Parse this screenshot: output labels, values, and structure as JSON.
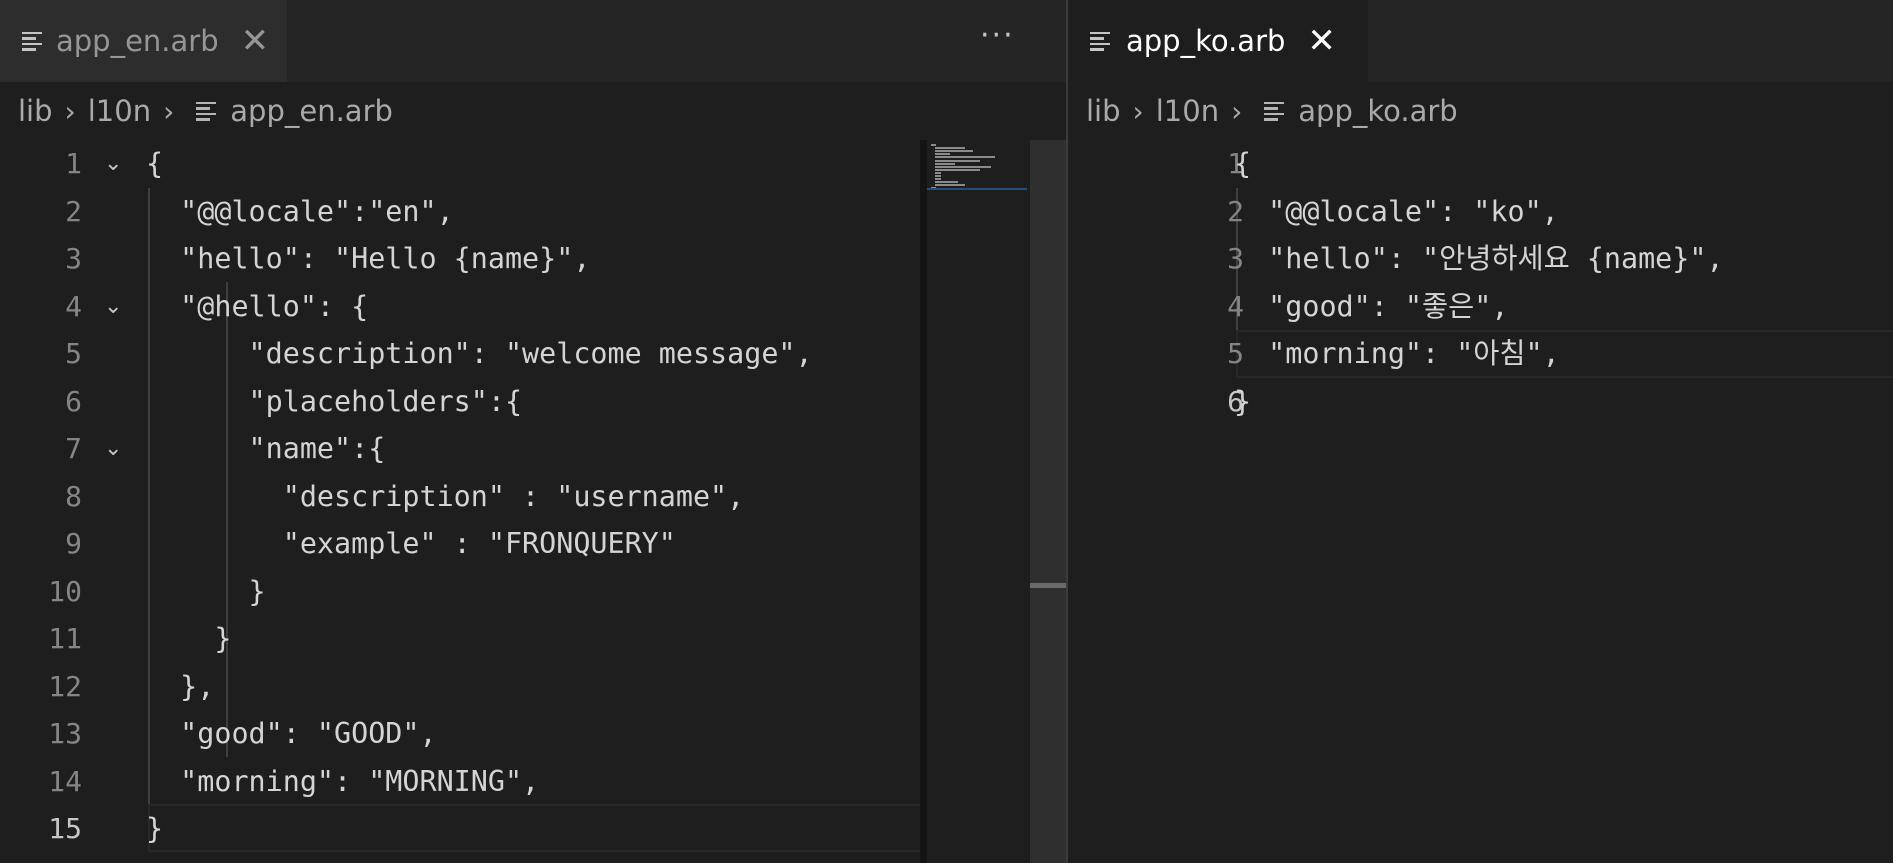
{
  "left": {
    "tab": {
      "label": "app_en.arb",
      "close_glyph": "✕"
    },
    "more_actions": "···",
    "breadcrumb": {
      "parts": [
        "lib",
        "l10n"
      ],
      "file": "app_en.arb"
    },
    "lines": [
      {
        "n": "1",
        "text": "{"
      },
      {
        "n": "2",
        "text": "  \"@@locale\":\"en\","
      },
      {
        "n": "3",
        "text": "  \"hello\": \"Hello {name}\","
      },
      {
        "n": "4",
        "text": "  \"@hello\": {"
      },
      {
        "n": "5",
        "text": "      \"description\": \"welcome message\","
      },
      {
        "n": "6",
        "text": "      \"placeholders\":{"
      },
      {
        "n": "7",
        "text": "      \"name\":{"
      },
      {
        "n": "8",
        "text": "        \"description\" : \"username\","
      },
      {
        "n": "9",
        "text": "        \"example\" : \"FRONQUERY\""
      },
      {
        "n": "10",
        "text": "      }"
      },
      {
        "n": "11",
        "text": "    }"
      },
      {
        "n": "12",
        "text": "  },"
      },
      {
        "n": "13",
        "text": "  \"good\": \"GOOD\","
      },
      {
        "n": "14",
        "text": "  \"morning\": \"MORNING\","
      },
      {
        "n": "15",
        "text": "}"
      }
    ],
    "current_line": "15"
  },
  "right": {
    "tab": {
      "label": "app_ko.arb",
      "close_glyph": "✕"
    },
    "breadcrumb": {
      "parts": [
        "lib",
        "l10n"
      ],
      "file": "app_ko.arb"
    },
    "lines": [
      {
        "n": "1",
        "text": "{"
      },
      {
        "n": "2",
        "text": "  \"@@locale\": \"ko\","
      },
      {
        "n": "3",
        "text": "  \"hello\": \"안녕하세요 {name}\","
      },
      {
        "n": "4",
        "text": "  \"good\": \"좋은\","
      },
      {
        "n": "5",
        "text": "  \"morning\": \"아침\","
      },
      {
        "n": "6",
        "text": "}"
      }
    ],
    "current_line": "6"
  },
  "icons": {
    "file": "file-lines-icon",
    "chevron": "chevron-right-icon",
    "fold": "chevron-down-icon",
    "close": "close-icon",
    "more": "more-actions-icon"
  },
  "colors": {
    "editor_bg": "#1e1e1e",
    "tab_inactive_bg": "#2d2d2d",
    "line_number": "#858585",
    "code_text": "#d4d4d4"
  }
}
